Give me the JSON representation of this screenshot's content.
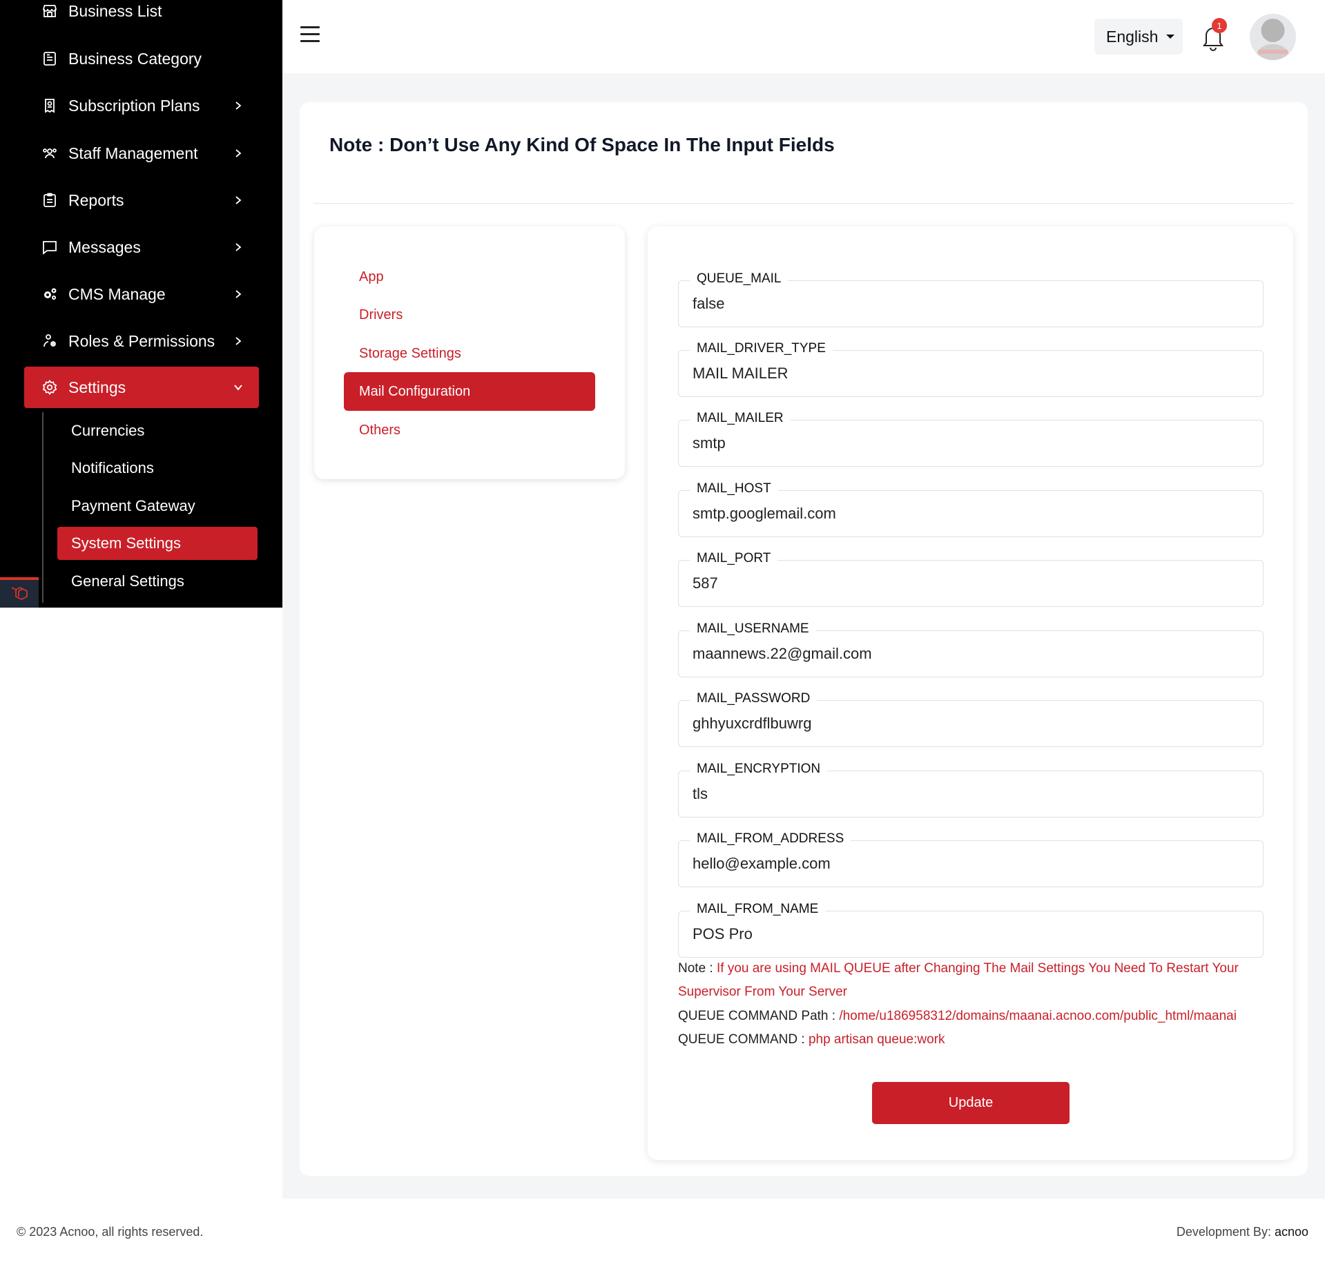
{
  "sidebar": {
    "items": [
      {
        "label": "Business List",
        "icon": "store-icon"
      },
      {
        "label": "Business Category",
        "icon": "document-list-icon"
      },
      {
        "label": "Subscription Plans",
        "icon": "receipt-icon"
      },
      {
        "label": "Staff Management",
        "icon": "users-icon"
      },
      {
        "label": "Reports",
        "icon": "clipboard-icon"
      },
      {
        "label": "Messages",
        "icon": "chat-icon"
      },
      {
        "label": "CMS Manage",
        "icon": "gears-icon"
      },
      {
        "label": "Roles & Permissions",
        "icon": "user-roles-icon"
      },
      {
        "label": "Settings",
        "icon": "gear-icon"
      }
    ],
    "sub_items": [
      {
        "label": "Currencies"
      },
      {
        "label": "Notifications"
      },
      {
        "label": "Payment Gateway"
      },
      {
        "label": "System Settings"
      },
      {
        "label": "General Settings"
      }
    ]
  },
  "header": {
    "language": "English",
    "notification_count": "1"
  },
  "page": {
    "note_title": "Note : Don’t Use Any Kind Of Space In The Input Fields"
  },
  "tabs": [
    {
      "label": "App"
    },
    {
      "label": "Drivers"
    },
    {
      "label": "Storage Settings"
    },
    {
      "label": "Mail Configuration"
    },
    {
      "label": "Others"
    }
  ],
  "fields": [
    {
      "label": "QUEUE_MAIL",
      "value": "false"
    },
    {
      "label": "MAIL_DRIVER_TYPE",
      "value": "MAIL MAILER"
    },
    {
      "label": "MAIL_MAILER",
      "value": "smtp"
    },
    {
      "label": "MAIL_HOST",
      "value": "smtp.googlemail.com"
    },
    {
      "label": "MAIL_PORT",
      "value": "587"
    },
    {
      "label": "MAIL_USERNAME",
      "value": "maannews.22@gmail.com"
    },
    {
      "label": "MAIL_PASSWORD",
      "value": "ghhyuxcrdflbuwrg"
    },
    {
      "label": "MAIL_ENCRYPTION",
      "value": "tls"
    },
    {
      "label": "MAIL_FROM_ADDRESS",
      "value": "hello@example.com"
    },
    {
      "label": "MAIL_FROM_NAME",
      "value": "POS Pro"
    }
  ],
  "info": {
    "note_label": "Note : ",
    "note_text": "If you are using MAIL QUEUE after Changing The Mail Settings You Need To Restart Your Supervisor From Your Server",
    "path_label": "QUEUE COMMAND Path : ",
    "path_value": "/home/u186958312/domains/maanai.acnoo.com/public_html/maanai",
    "command_label": "QUEUE COMMAND : ",
    "command_value": "php artisan queue:work"
  },
  "buttons": {
    "update": "Update"
  },
  "footer": {
    "copyright": "© 2023 Acnoo, all rights reserved.",
    "dev_label": "Development By: ",
    "dev_name": "acnoo"
  },
  "colors": {
    "accent": "#c91f28",
    "sidebar_bg": "#000000",
    "content_bg": "#f4f5f7"
  }
}
